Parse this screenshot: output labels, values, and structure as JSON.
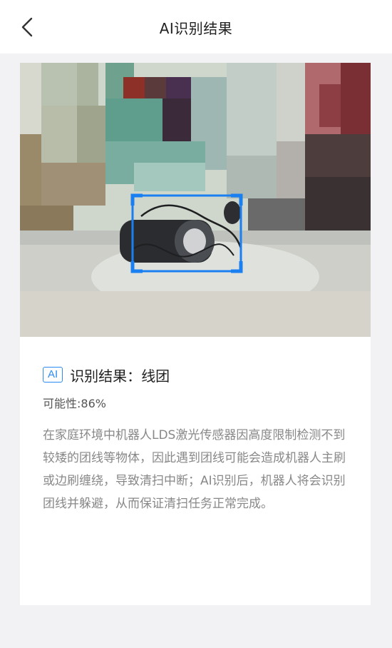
{
  "nav": {
    "title": "AI识别结果",
    "back_icon": "chevron-left-icon"
  },
  "result": {
    "badge": "AI",
    "label": "识别结果：",
    "value": "线团",
    "probability_label": "可能性:",
    "probability_value": "86%",
    "description": "在家庭环境中机器人LDS激光传感器因高度限制检测不到较矮的团线等物体，因此遇到团线可能会造成机器人主刷或边刷缠绕，导致清扫中断；AI识别后，机器人将会识别团线并躲避，从而保证清扫任务正常完成。"
  },
  "colors": {
    "accent": "#2b8bf2",
    "detection_box": "#1a7ff0",
    "background": "#f2f2f4"
  }
}
